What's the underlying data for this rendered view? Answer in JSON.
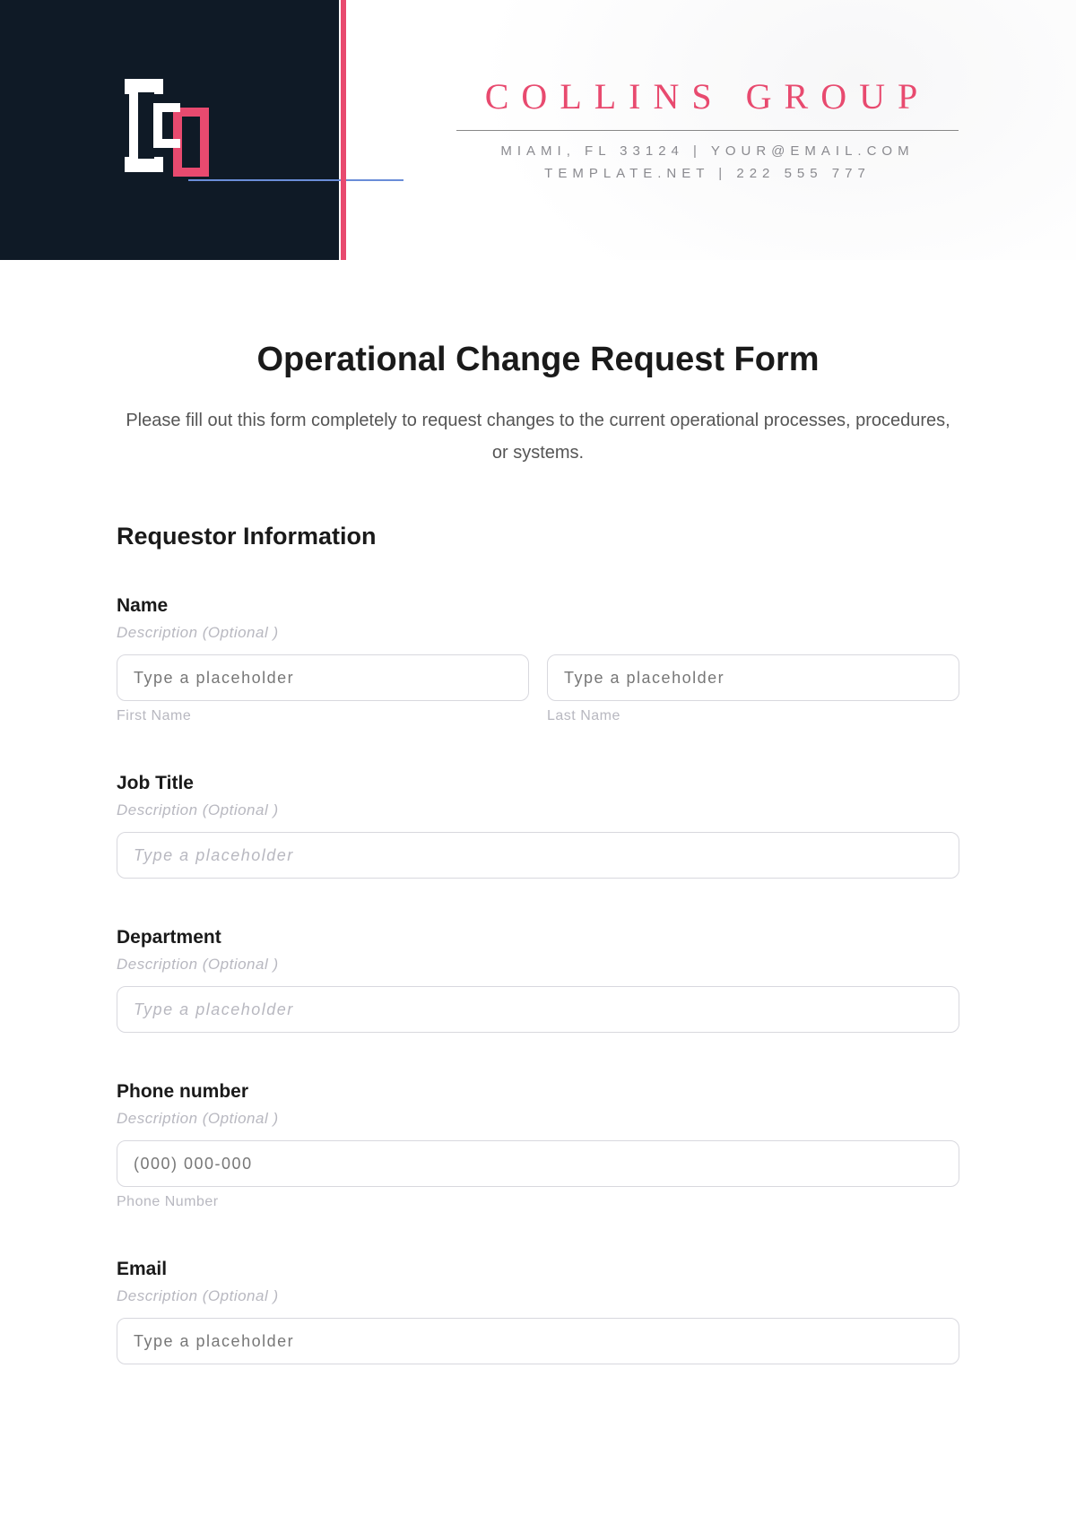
{
  "header": {
    "brand_name": "COLLINS GROUP",
    "address_line1": "MIAMI, FL 33124 | YOUR@EMAIL.COM",
    "address_line2": "TEMPLATE.NET | 222 555 777"
  },
  "form": {
    "title": "Operational Change Request Form",
    "intro": "Please fill out this form completely to request changes to the current operational processes, procedures, or systems.",
    "section_title": "Requestor Information",
    "fields": {
      "name": {
        "label": "Name",
        "desc": "Description (Optional )",
        "first_placeholder": "Type a placeholder",
        "last_placeholder": "Type a placeholder",
        "first_sub": "First Name",
        "last_sub": "Last Name"
      },
      "job_title": {
        "label": "Job Title",
        "desc": "Description (Optional )",
        "placeholder": "Type a placeholder"
      },
      "department": {
        "label": "Department",
        "desc": "Description (Optional )",
        "placeholder": "Type a placeholder"
      },
      "phone": {
        "label": "Phone number",
        "desc": "Description (Optional )",
        "placeholder": "(000) 000-000",
        "sub": "Phone Number"
      },
      "email": {
        "label": "Email",
        "desc": "Description (Optional )",
        "placeholder": "Type a placeholder"
      }
    }
  }
}
